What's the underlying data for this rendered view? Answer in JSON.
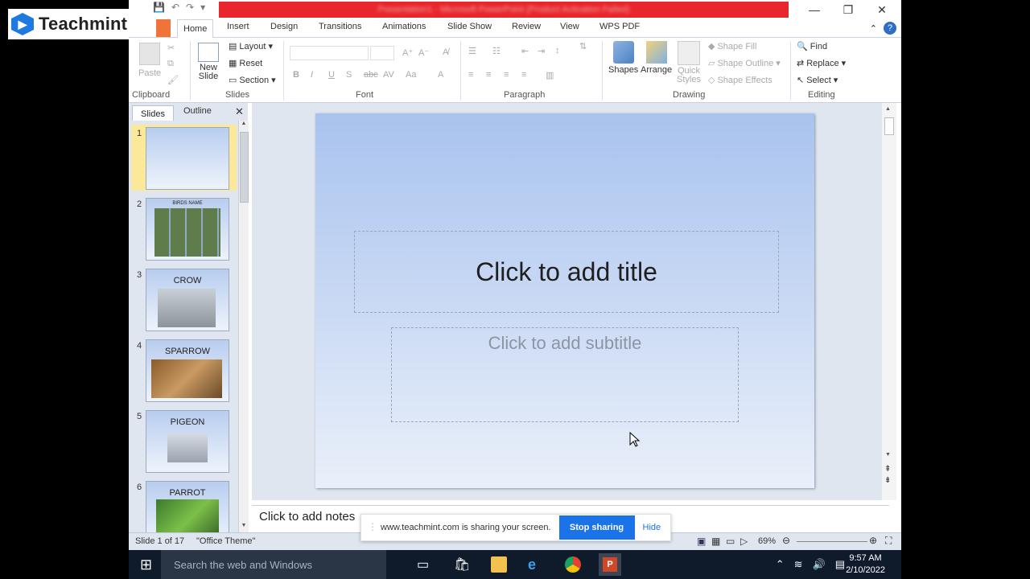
{
  "brand": {
    "name": "Teachmint"
  },
  "window": {
    "title_blurred": "Presentation1 - Microsoft PowerPoint (Product Activation Failed)"
  },
  "tabs": [
    "Home",
    "Insert",
    "Design",
    "Transitions",
    "Animations",
    "Slide Show",
    "Review",
    "View",
    "WPS PDF"
  ],
  "ribbon": {
    "paste": "Paste",
    "new_slide": "New Slide",
    "layout": "Layout",
    "reset": "Reset",
    "section": "Section",
    "shapes": "Shapes",
    "arrange": "Arrange",
    "quick_styles": "Quick Styles",
    "shape_fill": "Shape Fill",
    "shape_outline": "Shape Outline",
    "shape_effects": "Shape Effects",
    "find": "Find",
    "replace": "Replace",
    "select": "Select",
    "groups": {
      "clipboard": "Clipboard",
      "slides": "Slides",
      "font": "Font",
      "paragraph": "Paragraph",
      "drawing": "Drawing",
      "editing": "Editing"
    }
  },
  "pane": {
    "slides_tab": "Slides",
    "outline_tab": "Outline"
  },
  "thumbnails": [
    {
      "num": "1",
      "title": ""
    },
    {
      "num": "2",
      "title": "BIRDS NAME"
    },
    {
      "num": "3",
      "title": "CROW"
    },
    {
      "num": "4",
      "title": "SPARROW"
    },
    {
      "num": "5",
      "title": "PIGEON"
    },
    {
      "num": "6",
      "title": "PARROT"
    }
  ],
  "slide": {
    "title_placeholder": "Click to add title",
    "subtitle_placeholder": "Click to add subtitle"
  },
  "notes": {
    "placeholder": "Click to add notes"
  },
  "status": {
    "slide_count": "Slide 1 of 17",
    "theme": "\"Office Theme\"",
    "zoom": "69%"
  },
  "share_banner": {
    "text": "www.teachmint.com is sharing your screen.",
    "stop": "Stop sharing",
    "hide": "Hide"
  },
  "taskbar": {
    "search": "Search the web and Windows",
    "time": "9:57 AM",
    "date": "2/10/2022"
  }
}
